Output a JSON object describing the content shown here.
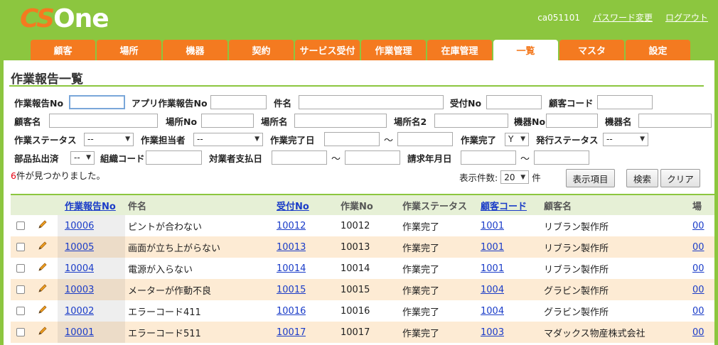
{
  "app": {
    "logo_cs": "CS",
    "logo_one": "One"
  },
  "user": {
    "id": "ca051101",
    "password_link": "パスワード変更",
    "logout_link": "ログアウト"
  },
  "tabs": [
    "顧客",
    "場所",
    "機器",
    "契約",
    "サービス受付",
    "作業管理",
    "在庫管理",
    "一覧",
    "マスタ",
    "設定"
  ],
  "active_tab": "一覧",
  "page_title": "作業報告一覧",
  "form": {
    "report_no": "作業報告No",
    "app_report_no": "アプリ作業報告No",
    "subject": "件名",
    "reception_no": "受付No",
    "customer_code": "顧客コード",
    "customer_name": "顧客名",
    "place_no": "場所No",
    "place_name": "場所名",
    "place_name2": "場所名2",
    "device_no": "機器No",
    "device_name": "機器名",
    "work_status": "作業ステータス",
    "work_status_value": "--",
    "work_person": "作業担当者",
    "work_person_value": "--",
    "work_done_date": "作業完了日",
    "tilde": "～",
    "work_done": "作業完了",
    "work_done_value": "Y",
    "issue_status": "発行ステータス",
    "issue_status_value": "--",
    "parts_paid": "部品払出済",
    "parts_paid_value": "--",
    "org_code": "組織コード",
    "contractor_pay_date": "対業者支払日",
    "billing_month": "請求年月日"
  },
  "result": {
    "count": "6",
    "suffix": "件が見つかりました。"
  },
  "paging": {
    "label": "表示件数:",
    "value": "20",
    "unit": "件"
  },
  "buttons": {
    "display_items": "表示項目",
    "search": "検索",
    "clear": "クリア"
  },
  "columns": [
    "作業報告No",
    "件名",
    "受付No",
    "作業No",
    "作業ステータス",
    "顧客コード",
    "顧客名",
    "場"
  ],
  "rows": [
    {
      "report_no": "10006",
      "subject": "ピントが合わない",
      "reception_no": "10012",
      "work_no": "10012",
      "status": "作業完了",
      "customer_code": "1001",
      "customer_name": "リブラン製作所",
      "place": "00"
    },
    {
      "report_no": "10005",
      "subject": "画面が立ち上がらない",
      "reception_no": "10013",
      "work_no": "10013",
      "status": "作業完了",
      "customer_code": "1001",
      "customer_name": "リブラン製作所",
      "place": "00"
    },
    {
      "report_no": "10004",
      "subject": "電源が入らない",
      "reception_no": "10014",
      "work_no": "10014",
      "status": "作業完了",
      "customer_code": "1001",
      "customer_name": "リブラン製作所",
      "place": "00"
    },
    {
      "report_no": "10003",
      "subject": "メーターが作動不良",
      "reception_no": "10015",
      "work_no": "10015",
      "status": "作業完了",
      "customer_code": "1004",
      "customer_name": "グラビン製作所",
      "place": "00"
    },
    {
      "report_no": "10002",
      "subject": "エラーコード411",
      "reception_no": "10016",
      "work_no": "10016",
      "status": "作業完了",
      "customer_code": "1004",
      "customer_name": "グラビン製作所",
      "place": "00"
    },
    {
      "report_no": "10001",
      "subject": "エラーコード511",
      "reception_no": "10017",
      "work_no": "10017",
      "status": "作業完了",
      "customer_code": "1003",
      "customer_name": "マダックス物産株式会社",
      "place": "00"
    }
  ],
  "colors": {
    "green": "#8cc63f",
    "orange": "#f47a20",
    "link": "#1a3cc8",
    "row_alt": "#fdebd4"
  }
}
